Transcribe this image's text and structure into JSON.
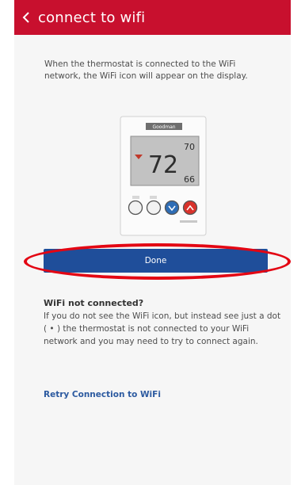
{
  "header": {
    "back_icon": "chevron-left-icon",
    "title": "connect to wifi"
  },
  "intro_text": "When the thermostat is connected to the WiFi network, the WiFi icon will appear on the display.",
  "thermostat": {
    "brand": "Goodman",
    "current_temp": "72",
    "setpoint_top": "70",
    "setpoint_bottom": "66",
    "arrow_color": "#c0392b",
    "down_button_color": "#2f6db5",
    "up_button_color": "#d9322b"
  },
  "done_button": {
    "label": "Done"
  },
  "not_connected": {
    "title": "WiFi not connected?",
    "body": "If you do not see the WiFi icon, but instead see just a dot ( • ) the thermostat is not connected to your WiFi network and you may need to try to connect again."
  },
  "retry_link": {
    "label": "Retry Connection to WiFi"
  },
  "colors": {
    "header": "#c8102e",
    "button": "#1f4e9a",
    "highlight": "#e30613",
    "link": "#2c5aa0"
  }
}
